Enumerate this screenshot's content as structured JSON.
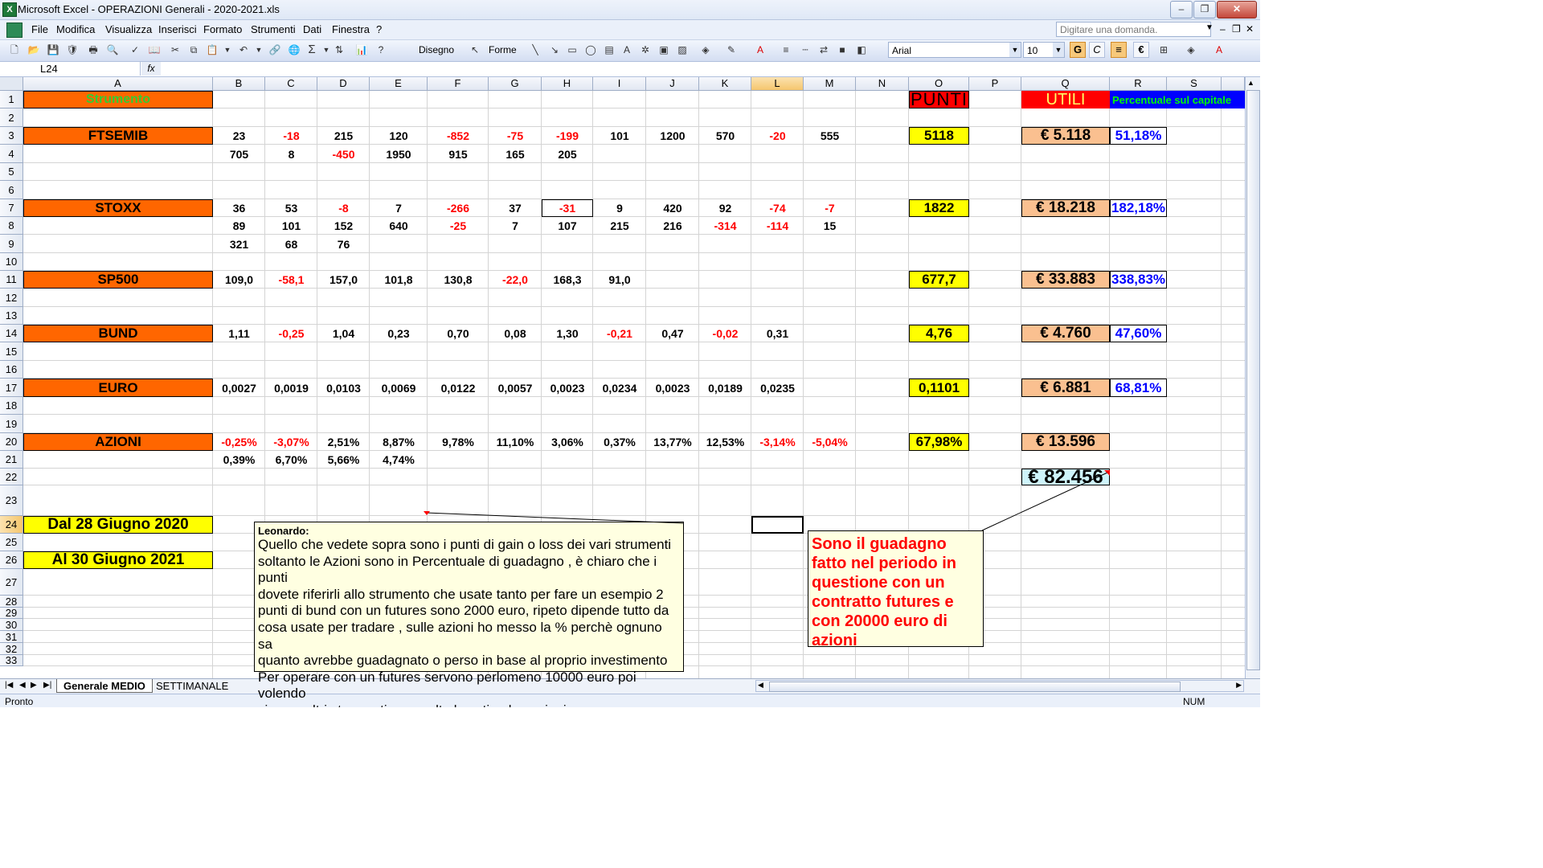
{
  "window": {
    "title": "Microsoft Excel - OPERAZIONI Generali - 2020-2021.xls"
  },
  "menu": [
    "File",
    "Modifica",
    "Visualizza",
    "Inserisci",
    "Formato",
    "Strumenti",
    "Dati",
    "Finestra",
    "?"
  ],
  "ask": {
    "placeholder": "Digitare una domanda."
  },
  "toolbar": {
    "disegno": "Disegno",
    "forme": "Forme",
    "font": "Arial",
    "size": "10",
    "bold": "G",
    "italic": "C",
    "euro": "€"
  },
  "namebox": "L24",
  "fx": "fx",
  "columns": [
    "A",
    "B",
    "C",
    "D",
    "E",
    "F",
    "G",
    "H",
    "I",
    "J",
    "K",
    "L",
    "M",
    "N",
    "O",
    "P",
    "Q",
    "R",
    "S"
  ],
  "selected_column": "L",
  "rows": [
    "1",
    "2",
    "3",
    "4",
    "5",
    "6",
    "7",
    "8",
    "9",
    "10",
    "11",
    "12",
    "13",
    "14",
    "15",
    "16",
    "17",
    "18",
    "19",
    "20",
    "21",
    "22",
    "23",
    "24",
    "25",
    "26",
    "27",
    "28",
    "29",
    "30",
    "31",
    "32",
    "33"
  ],
  "selected_row": "24",
  "headers": {
    "strumento": "Strumento",
    "punti": "PUNTI",
    "utili": "UTILI",
    "percentuale": "Percentuale sul capitale"
  },
  "instruments": [
    {
      "name": "FTSEMIB",
      "punti": "5118",
      "utili": "€ 5.118",
      "pct": "51,18%"
    },
    {
      "name": "STOXX",
      "punti": "1822",
      "utili": "€ 18.218",
      "pct": "182,18%"
    },
    {
      "name": "SP500",
      "punti": "677,7",
      "utili": "€ 33.883",
      "pct": "338,83%"
    },
    {
      "name": "BUND",
      "punti": "4,76",
      "utili": "€ 4.760",
      "pct": "47,60%"
    },
    {
      "name": "EURO",
      "punti": "0,1101",
      "utili": "€ 6.881",
      "pct": "68,81%"
    },
    {
      "name": "AZIONI",
      "punti": "67,98%",
      "utili": "€ 13.596"
    }
  ],
  "values": {
    "r3": [
      "23",
      "-18",
      "215",
      "120",
      "-852",
      "-75",
      "-199",
      "101",
      "1200",
      "570",
      "-20",
      "555"
    ],
    "r4": [
      "705",
      "8",
      "-450",
      "1950",
      "915",
      "165",
      "205"
    ],
    "r7": [
      "36",
      "53",
      "-8",
      "7",
      "-266",
      "37",
      "-31",
      "9",
      "420",
      "92",
      "-74",
      "-7"
    ],
    "r8": [
      "89",
      "101",
      "152",
      "640",
      "-25",
      "7",
      "107",
      "215",
      "216",
      "-314",
      "-114",
      "15"
    ],
    "r9": [
      "321",
      "68",
      "76"
    ],
    "r11": [
      "109,0",
      "-58,1",
      "157,0",
      "101,8",
      "130,8",
      "-22,0",
      "168,3",
      "91,0"
    ],
    "r14": [
      "1,11",
      "-0,25",
      "1,04",
      "0,23",
      "0,70",
      "0,08",
      "1,30",
      "-0,21",
      "0,47",
      "-0,02",
      "0,31"
    ],
    "r17": [
      "0,0027",
      "0,0019",
      "0,0103",
      "0,0069",
      "0,0122",
      "0,0057",
      "0,0023",
      "0,0234",
      "0,0023",
      "0,0189",
      "0,0235"
    ],
    "r20": [
      "-0,25%",
      "-3,07%",
      "2,51%",
      "8,87%",
      "9,78%",
      "11,10%",
      "3,06%",
      "0,37%",
      "13,77%",
      "12,53%",
      "-3,14%",
      "-5,04%"
    ],
    "r21": [
      "0,39%",
      "6,70%",
      "5,66%",
      "4,74%"
    ]
  },
  "total": "€ 82.456",
  "dates": {
    "from": "Dal 28 Giugno  2020",
    "to": "Al 30 Giugno 2021"
  },
  "comment1": {
    "author": "Leonardo:",
    "lines": [
      "Quello che vedete sopra sono i punti di gain o loss dei vari strumenti",
      "soltanto le Azioni sono in Percentuale di guadagno , è chiaro che i punti",
      "dovete riferirli allo strumento che usate tanto per fare un esempio 2",
      "punti di bund con un futures sono 2000 euro, ripeto dipende tutto da",
      "cosa usate per tradare , sulle azioni ho messo la % perchè ognuno sa",
      "quanto avrebbe guadagnato o perso in base al proprio investimento",
      "Per operare con un futures servono perlomeno 10000 euro poi volendo",
      "ci sono altri strumenti con molta leva tipo le opzioni"
    ]
  },
  "comment2": {
    "lines": [
      "Sono il guadagno",
      "fatto nel periodo in",
      "questione con un",
      "contratto futures e",
      "con 20000 euro di",
      "azioni"
    ]
  },
  "tabs": [
    "Generale MEDIO",
    "SETTIMANALE"
  ],
  "status": {
    "ready": "Pronto",
    "num": "NUM"
  },
  "colors": {
    "orange": "#ff6600",
    "yellow": "#ffff00",
    "peach": "#fac090",
    "red": "#ff0000",
    "blue": "#0000ff",
    "green": "#33cc33",
    "note": "#ffffe1"
  }
}
